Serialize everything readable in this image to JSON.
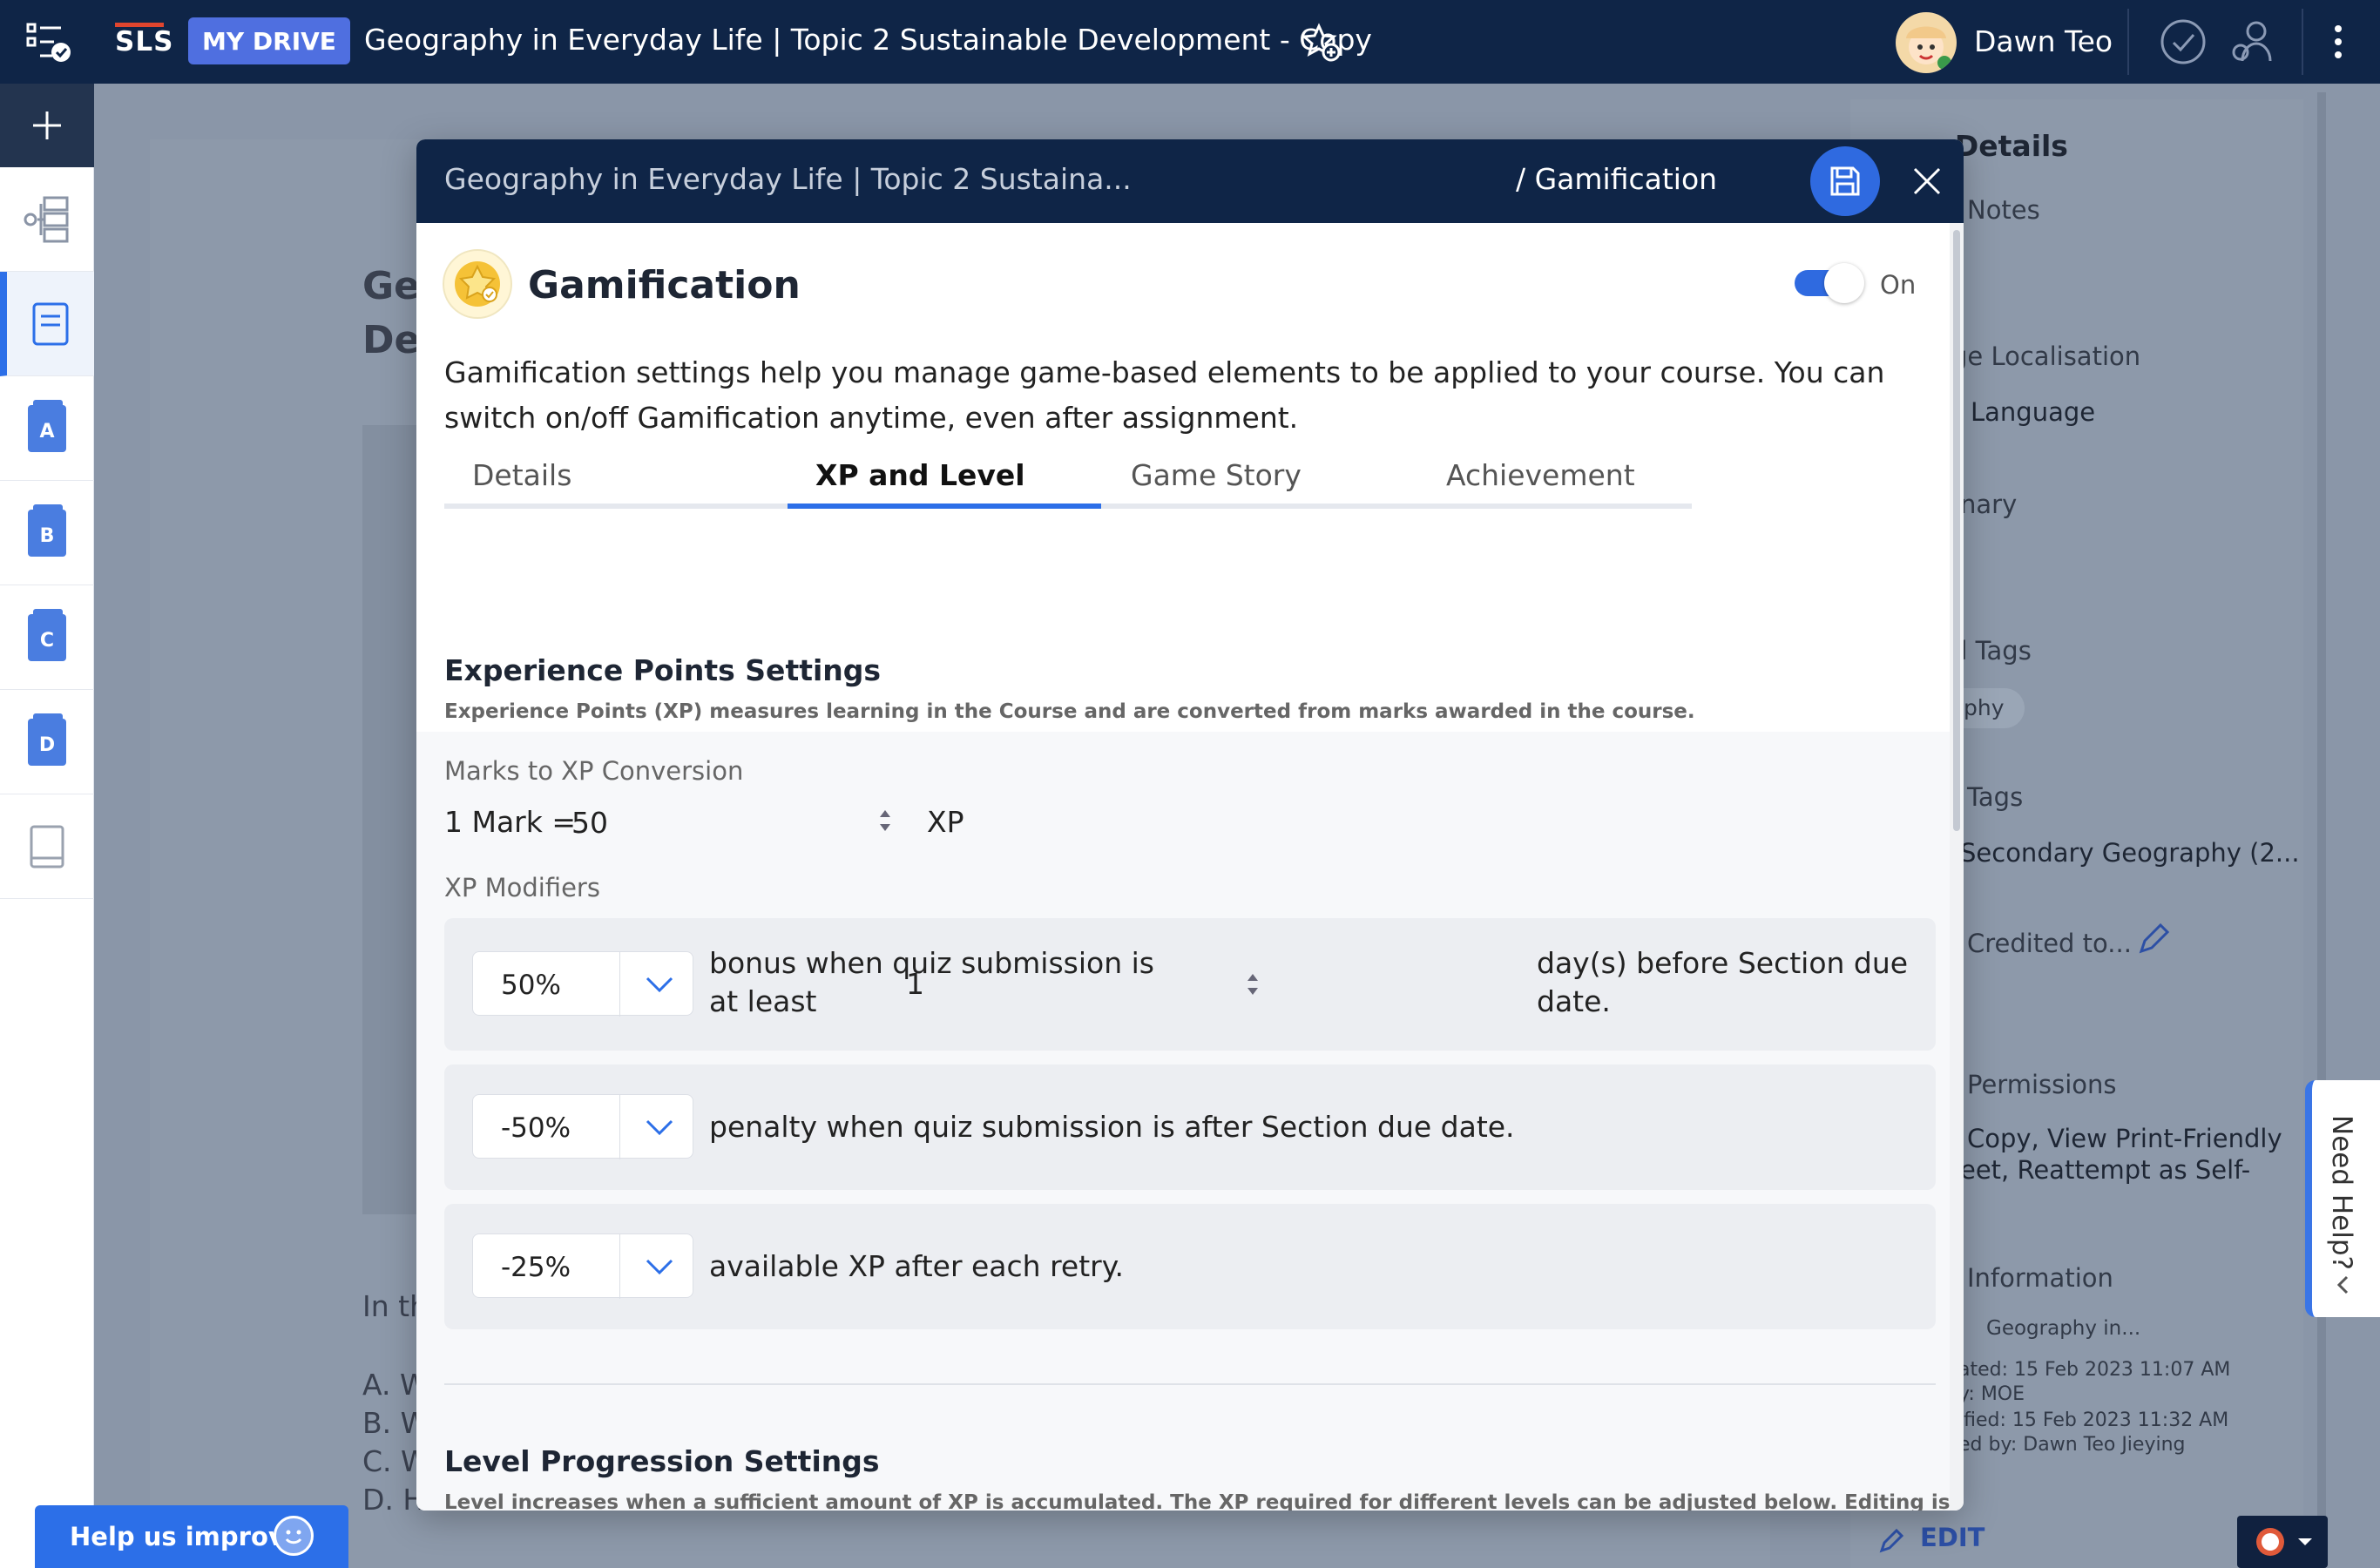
{
  "topbar": {
    "logo": "SLS",
    "drive_badge": "MY DRIVE",
    "doc_title": "Geography in Everyday Life | Topic 2 Sustainable Development - Copy",
    "user_name": "Dawn Teo"
  },
  "rail": {
    "sections": [
      "A",
      "B",
      "C",
      "D"
    ]
  },
  "background": {
    "heading_fragment_1": "Ge",
    "heading_fragment_2": "De",
    "text_fragment": "In th",
    "options": [
      "A. W",
      "B. W",
      "C. W",
      "D. H"
    ],
    "right_panel": {
      "title": "e Details",
      "notes": "Notes",
      "localisation": "ge Localisation",
      "language": "Language",
      "glossary": "nary",
      "tags": "d Tags",
      "tag_chip": "phy",
      "subject_tags": "Tags",
      "subject_value": "Secondary Geography (2...",
      "credited": "Credited to...",
      "permissions": "Permissions",
      "permissions_line1": "Copy, View Print-Friendly",
      "permissions_line2": "eet, Reattempt as Self-",
      "information": "Information",
      "info_crumb": "Geography in...",
      "created": "ated: 15 Feb 2023 11:07 AM",
      "by": "y: MOE",
      "modified": "ified: 15 Feb 2023 11:32 AM",
      "modified_by": "ed by: Dawn Teo Jieying",
      "edit": "EDIT"
    },
    "need_help": "Need Help?",
    "help_improve": "Help us improve"
  },
  "modal": {
    "breadcrumb": "Geography in Everyday Life | Topic 2 Sustaina...",
    "current": "/ Gamification",
    "title": "Gamification",
    "toggle_state": "On",
    "description": "Gamification settings help you manage game-based elements to be applied to your course. You can switch on/off Gamification anytime, even after assignment.",
    "tabs": [
      "Details",
      "XP and Level",
      "Game Story",
      "Achievement"
    ],
    "active_tab": "XP and Level",
    "xp": {
      "section_title": "Experience Points Settings",
      "section_desc": "Experience Points (XP) measures learning in the Course and are converted from marks awarded in the course.",
      "conversion_label": "Marks to XP Conversion",
      "mark_prefix": "1 Mark =",
      "mark_value": "50",
      "unit": "XP",
      "modifiers_label": "XP Modifiers",
      "bonus": {
        "percent": "50%",
        "text_a": "bonus when quiz submission is at least",
        "days": "1",
        "text_b": "day(s) before Section due date."
      },
      "penalty": {
        "percent": "-50%",
        "text": "penalty when quiz submission is after Section due date."
      },
      "retry": {
        "percent": "-25%",
        "text": "available XP after each retry."
      }
    },
    "level": {
      "section_title": "Level Progression Settings",
      "section_desc": "Level increases when a sufficient amount of XP is accumulated. The XP required for different levels can be adjusted below. Editing is not"
    }
  },
  "colors": {
    "navy": "#0f2547",
    "accent": "#2c6fe8",
    "drive_badge": "#4f6fe0"
  }
}
